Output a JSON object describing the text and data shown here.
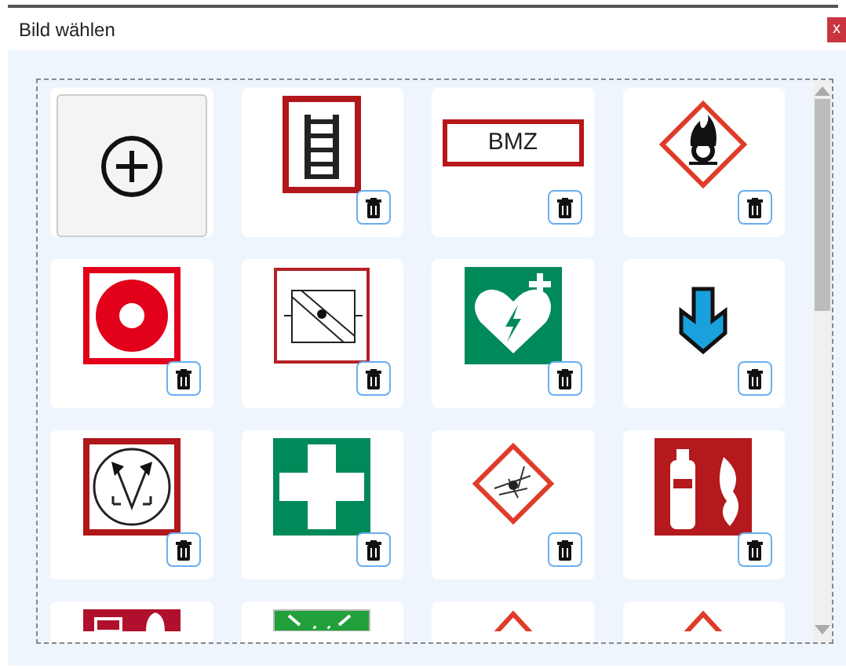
{
  "window": {
    "title": "Bild wählen",
    "close_label": "x"
  },
  "tiles": [
    {
      "kind": "add"
    },
    {
      "kind": "ladder"
    },
    {
      "kind": "label",
      "text": "BMZ"
    },
    {
      "kind": "oxidizer"
    },
    {
      "kind": "fire-alarm"
    },
    {
      "kind": "damper"
    },
    {
      "kind": "defibrillator"
    },
    {
      "kind": "down-arrow"
    },
    {
      "kind": "valve"
    },
    {
      "kind": "first-aid"
    },
    {
      "kind": "explosive"
    },
    {
      "kind": "extinguisher"
    }
  ],
  "tiles_cut_off": [
    {
      "kind": "alarm"
    },
    {
      "kind": "assembly"
    },
    {
      "kind": "hazard"
    },
    {
      "kind": "hazard"
    }
  ]
}
